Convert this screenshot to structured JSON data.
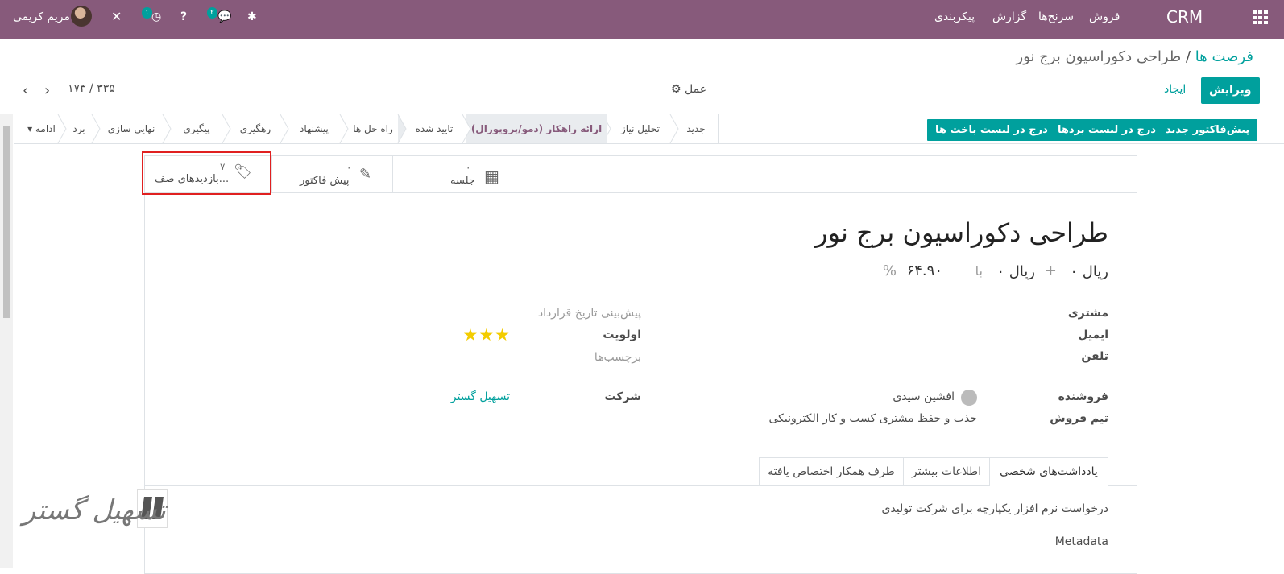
{
  "topbar": {
    "app": "CRM",
    "menu": [
      "فروش",
      "سرنخ‌ها",
      "گزارش",
      "پیکربندی"
    ],
    "user": "مریم کریمی",
    "chat_badge": "۲",
    "activity_badge": "۱"
  },
  "breadcrumb": {
    "parent": "فرصت ها",
    "sep": "/",
    "current": "طراحی دکوراسیون برج نور"
  },
  "controls": {
    "edit": "ویرایش",
    "create": "ایجاد",
    "action": "عمل",
    "pager": "۱۷۳ / ۳۳۵"
  },
  "header_buttons": [
    "پیش‌فاکتور جدید",
    "درج در لیست بردها",
    "درج در لیست باخت ها"
  ],
  "stages": [
    "جدید",
    "تحلیل نیاز",
    "ارائه راهکار (دمو/پروپوزال)",
    "تایید شده",
    "راه حل ها",
    "پیشنهاد",
    "رهگیری",
    "پیگیری",
    "نهایی سازی",
    "برد"
  ],
  "stage_more": "ادامه",
  "active_stage": 2,
  "smart_buttons": {
    "meeting_count": "۰",
    "meeting_label": "جلسه",
    "quote_count": "۰",
    "quote_label": "پیش فاکتور",
    "visits_count": "۷",
    "visits_label": "بازدیدهای صف..."
  },
  "record": {
    "title": "طراحی دکوراسیون برج نور",
    "revenue": "۰ ریال",
    "plus": "+",
    "recurring": "۰ ریال",
    "at": "با",
    "probability": "۶۴.۹۰",
    "percent": "%",
    "labels": {
      "customer": "مشتری",
      "email": "ایمیل",
      "phone": "تلفن",
      "expected_closing": "پیش‌بینی تاریخ قرارداد",
      "priority": "اولویت",
      "tags": "برچسب‌ها",
      "salesperson": "فروشنده",
      "sales_team": "تیم فروش",
      "company": "شرکت"
    },
    "values": {
      "salesperson": "افشین سیدی",
      "sales_team": "جذب و حفظ مشتری کسب و کار الکترونیکی",
      "company": "تسهیل گستر"
    },
    "priority_stars": 3
  },
  "tabs": [
    "یادداشت‌های شخصی",
    "اطلاعات بیشتر",
    "طرف همکار اختصاص یافته"
  ],
  "notes": {
    "text": "درخواست نرم افزار یکپارچه برای شرکت تولیدی",
    "metadata": "Metadata"
  },
  "watermark": "تسهیل گستر"
}
